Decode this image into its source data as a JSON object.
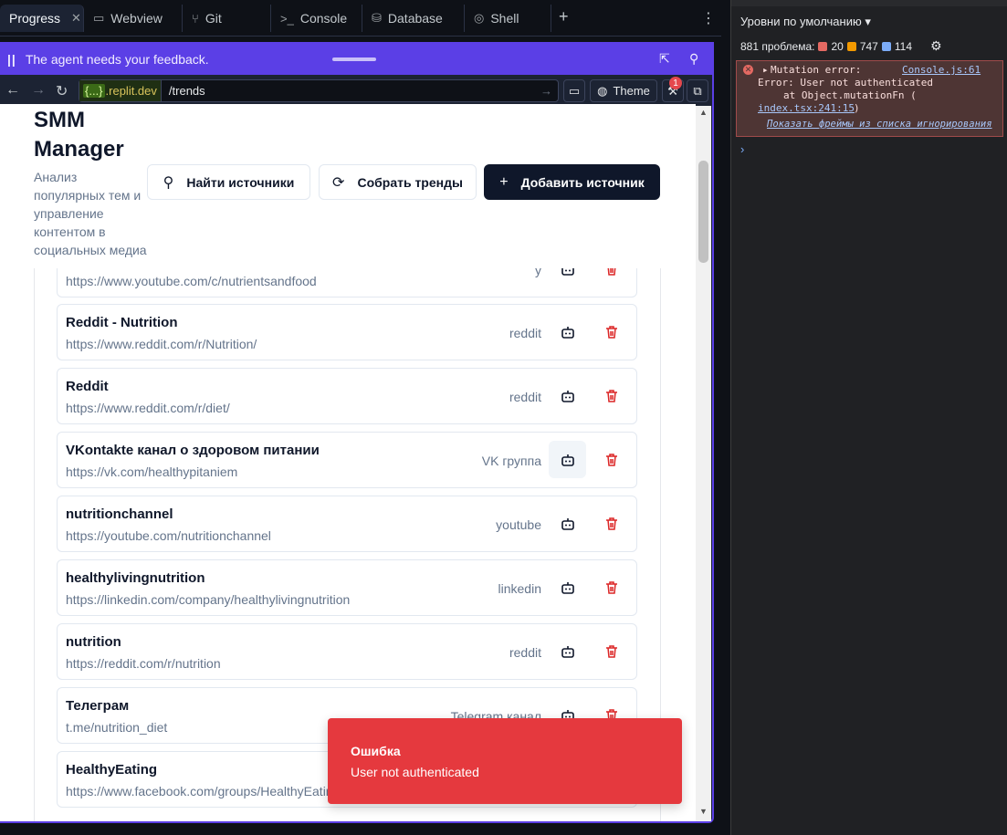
{
  "tabs": [
    {
      "label": "Progress",
      "icon": "progress-icon",
      "active": true
    },
    {
      "label": "Webview",
      "icon": "monitor-icon"
    },
    {
      "label": "Git",
      "icon": "git-icon"
    },
    {
      "label": "Console",
      "icon": "console-icon"
    },
    {
      "label": "Database",
      "icon": "database-icon"
    },
    {
      "label": "Shell",
      "icon": "shell-icon"
    }
  ],
  "feedback": {
    "text": "The agent needs your feedback."
  },
  "urlbar": {
    "host_prefix": "{...}",
    "host": ".replit.dev",
    "path": "/trends",
    "theme_label": "Theme",
    "badge": "1"
  },
  "app": {
    "title_line1": "SMM",
    "title_line2": "Manager",
    "subtitle": "Анализ популярных тем и управление контентом в социальных медиа",
    "buttons": {
      "find": "Найти источники",
      "collect": "Собрать тренды",
      "add": "Добавить источник"
    }
  },
  "sources": [
    {
      "name": "",
      "url": "https://www.youtube.com/c/nutrientsandfood",
      "type": "y"
    },
    {
      "name": "Reddit - Nutrition",
      "url": "https://www.reddit.com/r/Nutrition/",
      "type": "reddit"
    },
    {
      "name": "Reddit",
      "url": "https://www.reddit.com/r/diet/",
      "type": "reddit"
    },
    {
      "name": "VKontakte канал о здоровом питании",
      "url": "https://vk.com/healthypitaniem",
      "type": "VK группа"
    },
    {
      "name": "nutritionchannel",
      "url": "https://youtube.com/nutritionchannel",
      "type": "youtube"
    },
    {
      "name": "healthylivingnutrition",
      "url": "https://linkedin.com/company/healthylivingnutrition",
      "type": "linkedin"
    },
    {
      "name": "nutrition",
      "url": "https://reddit.com/r/nutrition",
      "type": "reddit"
    },
    {
      "name": "Телеграм",
      "url": "t.me/nutrition_diet",
      "type": "Telegram канал"
    },
    {
      "name": "HealthyEating",
      "url": "https://www.facebook.com/groups/HealthyEating",
      "type": ""
    }
  ],
  "toast": {
    "title": "Ошибка",
    "message": "User not authenticated"
  },
  "devtools": {
    "levels": "Уровни по умолчанию ▾",
    "issues_label": "881 проблема:",
    "errors": "20",
    "warnings": "747",
    "infos": "114",
    "error_line1": "Mutation error:",
    "error_source": "Console.js:61",
    "error_line2": "Error: User not authenticated",
    "error_line3": "at Object.mutationFn (",
    "error_link": "index.tsx:241:15",
    "error_close": ")",
    "show_frames": "Показать фреймы из списка игнорирования",
    "prompt": "›"
  }
}
